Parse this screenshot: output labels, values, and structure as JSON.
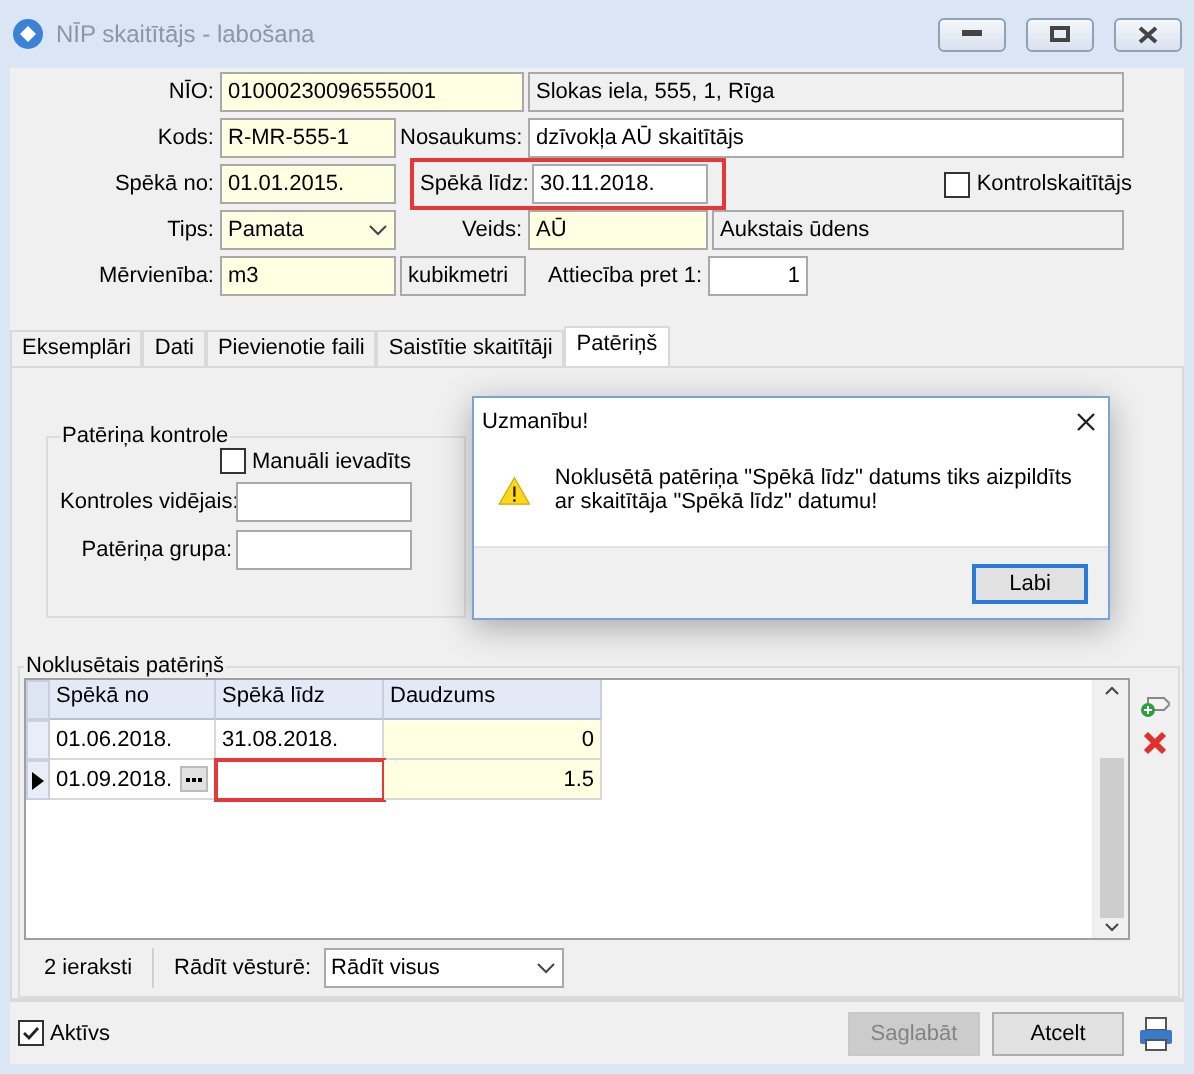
{
  "window": {
    "title": "NĪP skaitītājs - labošana"
  },
  "form": {
    "nio": {
      "label": "NĪO:",
      "value": "01000230096555001",
      "address": "Slokas iela, 555, 1, Rīga"
    },
    "kods": {
      "label": "Kods:",
      "value": "R-MR-555-1"
    },
    "nosaukums": {
      "label": "Nosaukums:",
      "value": "dzīvokļa AŪ skaitītājs"
    },
    "speka_no": {
      "label": "Spēkā no:",
      "value": "01.01.2015."
    },
    "speka_lidz": {
      "label": "Spēkā līdz:",
      "value": "30.11.2018.",
      "highlighted": true
    },
    "kontrolskaititajs": {
      "label": "Kontrolskaitītājs",
      "checked": false
    },
    "tips": {
      "label": "Tips:",
      "value": "Pamata"
    },
    "veids": {
      "label": "Veids:",
      "value": "AŪ",
      "description": "Aukstais ūdens"
    },
    "mervieniba": {
      "label": "Mērvienība:",
      "value": "m3",
      "description": "kubikmetri"
    },
    "attieciba": {
      "label": "Attiecība pret 1:",
      "value": "1"
    }
  },
  "tabs": [
    {
      "label": "Eksemplāri",
      "selected": false
    },
    {
      "label": "Dati",
      "selected": false
    },
    {
      "label": "Pievienotie faili",
      "selected": false
    },
    {
      "label": "Saistītie skaitītāji",
      "selected": false
    },
    {
      "label": "Patēriņš",
      "selected": true
    }
  ],
  "control_group": {
    "title": "Patēriņa kontrole",
    "manual": {
      "label": "Manuāli ievadīts",
      "checked": false
    },
    "average": {
      "label": "Kontroles vidējais:"
    },
    "group": {
      "label": "Patēriņa grupa:"
    }
  },
  "default_consumption": {
    "title": "Noklusētais patēriņš",
    "columns": [
      "Spēkā no",
      "Spēkā līdz",
      "Daudzums"
    ],
    "rows": [
      {
        "from": "01.06.2018.",
        "to": "31.08.2018.",
        "amount": "0",
        "current": false,
        "highlighted": false
      },
      {
        "from": "01.09.2018.",
        "to": "",
        "amount": "1.5",
        "current": true,
        "highlighted": true
      }
    ],
    "count": "2 ieraksti",
    "history_label": "Rādīt vēsturē:",
    "history_value": "Rādīt visus"
  },
  "active": {
    "label": "Aktīvs",
    "checked": true
  },
  "buttons": [
    {
      "label": "Saglabāt",
      "disabled": true
    },
    {
      "label": "Atcelt",
      "disabled": false
    }
  ],
  "dialog": {
    "title": "Uzmanību!",
    "message": "Noklusētā patēriņa \"Spēkā līdz\" datums tiks aizpildīts ar skaitītāja \"Spēkā līdz\" datumu!",
    "button": "Labi"
  }
}
